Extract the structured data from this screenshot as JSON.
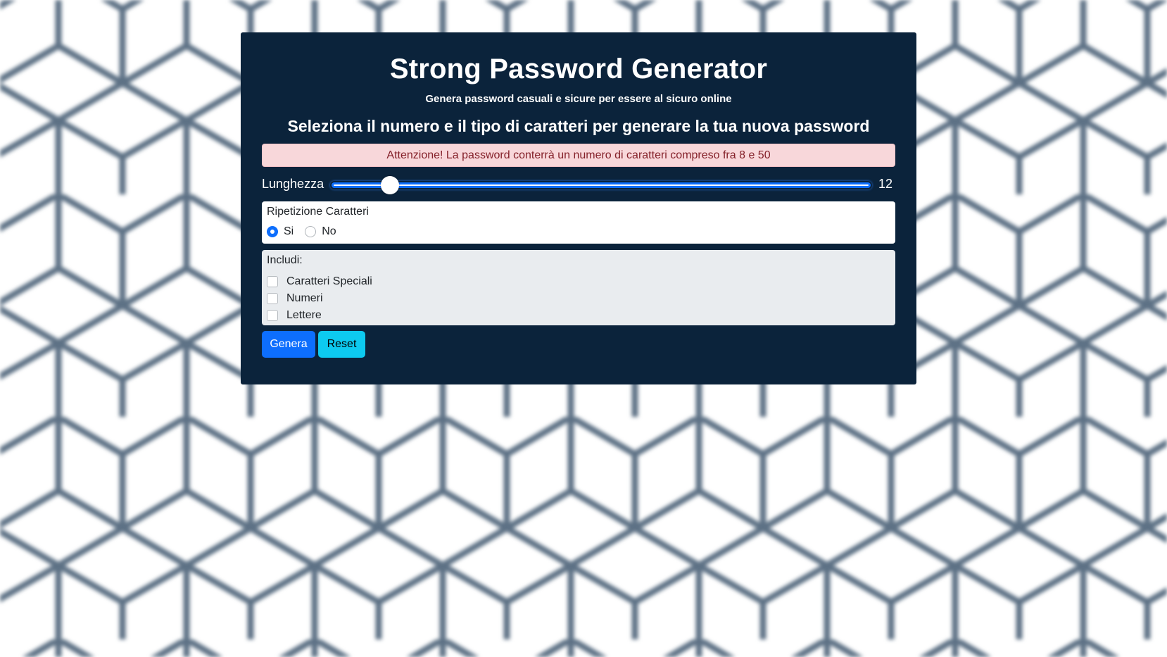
{
  "header": {
    "title": "Strong Password Generator",
    "subtitle": "Genera password casuali e sicure per essere al sicuro online"
  },
  "section_heading": "Seleziona il numero e il tipo di caratteri per generare la tua nuova password",
  "alert": {
    "text": "Attenzione! La password conterrà un numero di caratteri compreso fra 8 e 50"
  },
  "length": {
    "label": "Lunghezza",
    "min": 8,
    "max": 50,
    "value": 12,
    "display": "12"
  },
  "repetition": {
    "title": "Ripetizione Caratteri",
    "options": [
      {
        "label": "Si",
        "checked": true
      },
      {
        "label": "No",
        "checked": false
      }
    ]
  },
  "include": {
    "title": "Includi:",
    "options": [
      {
        "label": "Caratteri Speciali",
        "checked": false
      },
      {
        "label": "Numeri",
        "checked": false
      },
      {
        "label": "Lettere",
        "checked": false
      }
    ]
  },
  "buttons": {
    "generate": "Genera",
    "reset": "Reset"
  },
  "colors": {
    "card_bg": "#0b233b",
    "primary": "#0d6efd",
    "info": "#0dcaf0",
    "alert_bg": "#f8d7da",
    "alert_text": "#842029"
  }
}
